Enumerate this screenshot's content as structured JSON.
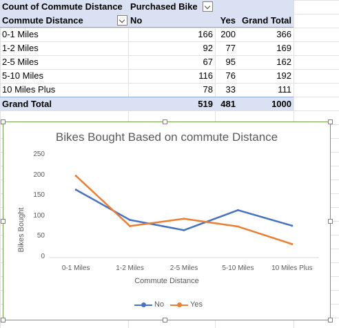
{
  "pivot": {
    "header1": {
      "label": "Count of Commute Distance",
      "column_field": "Purchased Bike"
    },
    "header2": {
      "row_field": "Commute Distance",
      "col_no": "No",
      "col_yes": "Yes",
      "col_total": "Grand Total"
    },
    "rows": [
      {
        "label": "0-1 Miles",
        "no": "166",
        "yes": "200",
        "total": "366"
      },
      {
        "label": "1-2 Miles",
        "no": "92",
        "yes": "77",
        "total": "169"
      },
      {
        "label": "2-5 Miles",
        "no": "67",
        "yes": "95",
        "total": "162"
      },
      {
        "label": "5-10 Miles",
        "no": "116",
        "yes": "76",
        "total": "192"
      },
      {
        "label": "10 Miles Plus",
        "no": "78",
        "yes": "33",
        "total": "111"
      }
    ],
    "grand_total": {
      "label": "Grand Total",
      "no": "519",
      "yes": "481",
      "total": "1000"
    },
    "colors": {
      "header_fill": "#d9e1f2",
      "border": "#8ea9db"
    }
  },
  "chart_data": {
    "type": "line",
    "title": "Bikes Bought Based on commute Distance",
    "xlabel": "Commute Distance",
    "ylabel": "Bikes Bought",
    "categories": [
      "0-1 Miles",
      "1-2 Miles",
      "2-5 Miles",
      "5-10 Miles",
      "10 Miles Plus"
    ],
    "series": [
      {
        "name": "No",
        "values": [
          166,
          92,
          67,
          116,
          78
        ],
        "color": "#4472c4"
      },
      {
        "name": "Yes",
        "values": [
          200,
          77,
          95,
          76,
          33
        ],
        "color": "#ed7d31"
      }
    ],
    "ylim": [
      0,
      250
    ],
    "yticks": [
      "0",
      "50",
      "100",
      "150",
      "200",
      "250"
    ],
    "grid": false,
    "legend": "bottom",
    "border_color": "#71a04a"
  }
}
